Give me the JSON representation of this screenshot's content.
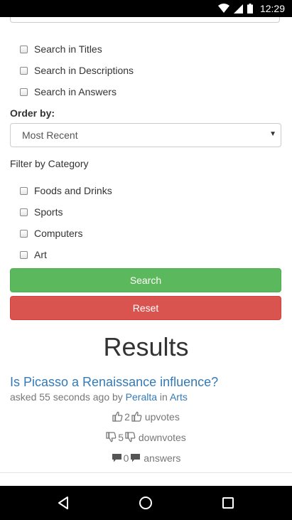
{
  "status_bar": {
    "time": "12:29"
  },
  "search_options": [
    {
      "label": "Search in Titles"
    },
    {
      "label": "Search in Descriptions"
    },
    {
      "label": "Search in Answers"
    }
  ],
  "order": {
    "label": "Order by:",
    "selected": "Most Recent"
  },
  "filter": {
    "label": "Filter by Category",
    "categories": [
      {
        "label": "Foods and Drinks"
      },
      {
        "label": "Sports"
      },
      {
        "label": "Computers"
      },
      {
        "label": "Art"
      }
    ]
  },
  "buttons": {
    "search": "Search",
    "reset": "Reset"
  },
  "results": {
    "heading": "Results",
    "question": {
      "title": "Is Picasso a Renaissance influence?",
      "asked_prefix": "asked 55 seconds ago by",
      "author": "Peralta",
      "in_word": "in",
      "category": "Arts",
      "upvotes": "2",
      "upvotes_label": "upvotes",
      "downvotes": "5",
      "downvotes_label": "downvotes",
      "answers": "0",
      "answers_label": "answers"
    }
  },
  "icons": {
    "thumbs_up": "thumbs-up-icon",
    "thumbs_down": "thumbs-down-icon",
    "comment": "comment-icon"
  },
  "colors": {
    "link": "#337ab7",
    "search_button": "#5cb85c",
    "reset_button": "#d9534f"
  }
}
